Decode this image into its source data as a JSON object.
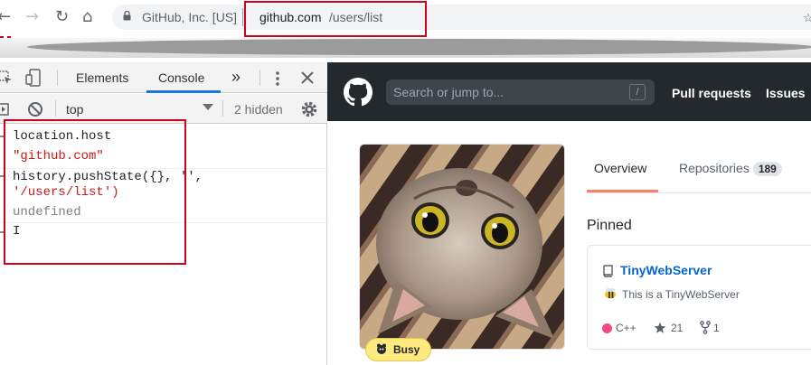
{
  "browser": {
    "site_identity": "GitHub, Inc. [US]",
    "url_host": "github.com",
    "url_path": "/users/list"
  },
  "devtools": {
    "tabs": {
      "elements": "Elements",
      "console": "Console",
      "more": "»"
    },
    "context": "top",
    "hidden_count": "2 hidden",
    "console_lines": {
      "cmd1": "location.host",
      "res1": "\"github.com\"",
      "cmd2a": "history.pushState({}, '',",
      "cmd2b": "'/users/list')",
      "res2": "undefined"
    }
  },
  "github": {
    "search_placeholder": "Search or jump to...",
    "slash_key": "/",
    "nav": {
      "pull_requests": "Pull requests",
      "issues": "Issues"
    },
    "status": "Busy",
    "tabs": {
      "overview": "Overview",
      "repositories": "Repositories",
      "repo_count": "189"
    },
    "pinned_label": "Pinned",
    "pinned_repo": {
      "name": "TinyWebServer",
      "description": "This is a TinyWebServer",
      "language": "C++",
      "language_color": "#f34b7d",
      "stars": "21",
      "forks": "1"
    }
  },
  "colors": {
    "highlight": "#d0021b",
    "gh_header": "#24292e",
    "link": "#0366d6"
  }
}
